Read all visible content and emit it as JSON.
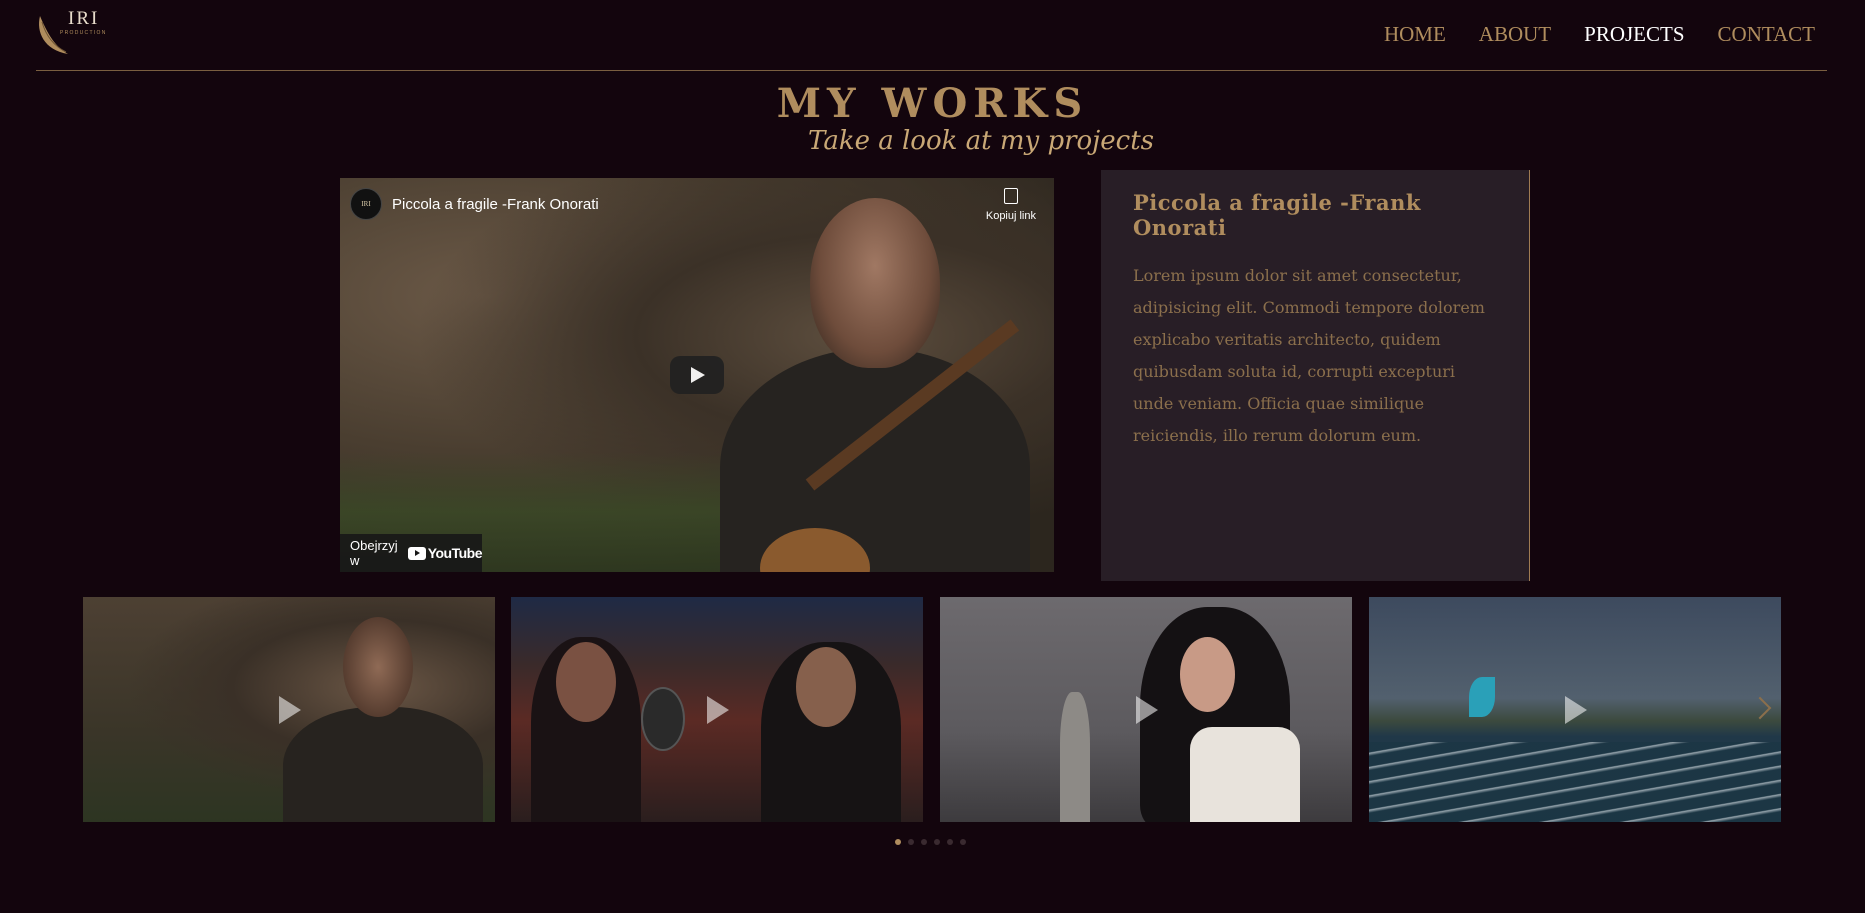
{
  "logo": {
    "brand": "IRI",
    "sub": "PRODUCTION"
  },
  "nav": {
    "items": [
      {
        "label": "HOME"
      },
      {
        "label": "ABOUT"
      },
      {
        "label": "PROJECTS",
        "active": true
      },
      {
        "label": "CONTACT"
      }
    ]
  },
  "heading": {
    "title": "MY WORKS",
    "subtitle": "Take a look at my projects"
  },
  "player": {
    "channel_avatar": "IRI",
    "video_title": "Piccola a fragile -Frank Onorati",
    "copy_link_label": "Kopiuj link",
    "watch_on_label": "Obejrzyj w",
    "youtube_label": "YouTube"
  },
  "card": {
    "title": "Piccola a fragile -Frank Onorati",
    "body": "Lorem ipsum dolor sit amet consectetur, adipisicing elit. Commodi tempore dolorem explicabo veritatis architecto, quidem quibusdam soluta id, corrupti excepturi unde veniam. Officia quae similique reiciendis, illo rerum dolorum eum."
  },
  "carousel": {
    "thumbnails": [
      {
        "icon": "play-icon"
      },
      {
        "icon": "play-icon"
      },
      {
        "icon": "play-icon"
      },
      {
        "icon": "play-icon"
      }
    ],
    "dot_count": 6,
    "active_dot": 0
  },
  "colors": {
    "background": "#13050d",
    "accent": "#b08d5e",
    "card_bg": "#281e26",
    "nav_active": "#ffffff"
  }
}
